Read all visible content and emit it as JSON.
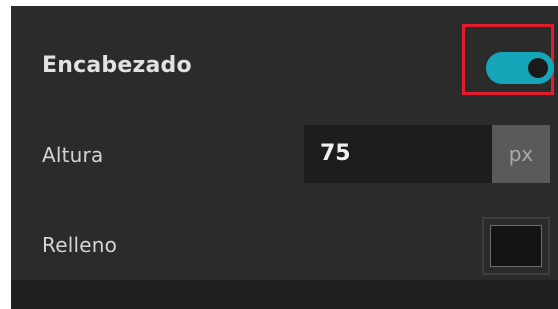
{
  "header": {
    "label": "Encabezado",
    "toggle_on": true,
    "toggle_color": "#16a5b8"
  },
  "height": {
    "label": "Altura",
    "value": "75",
    "unit": "px"
  },
  "fill": {
    "label": "Relleno",
    "swatch_color": "#141414"
  },
  "highlight_color": "#e21c2a"
}
